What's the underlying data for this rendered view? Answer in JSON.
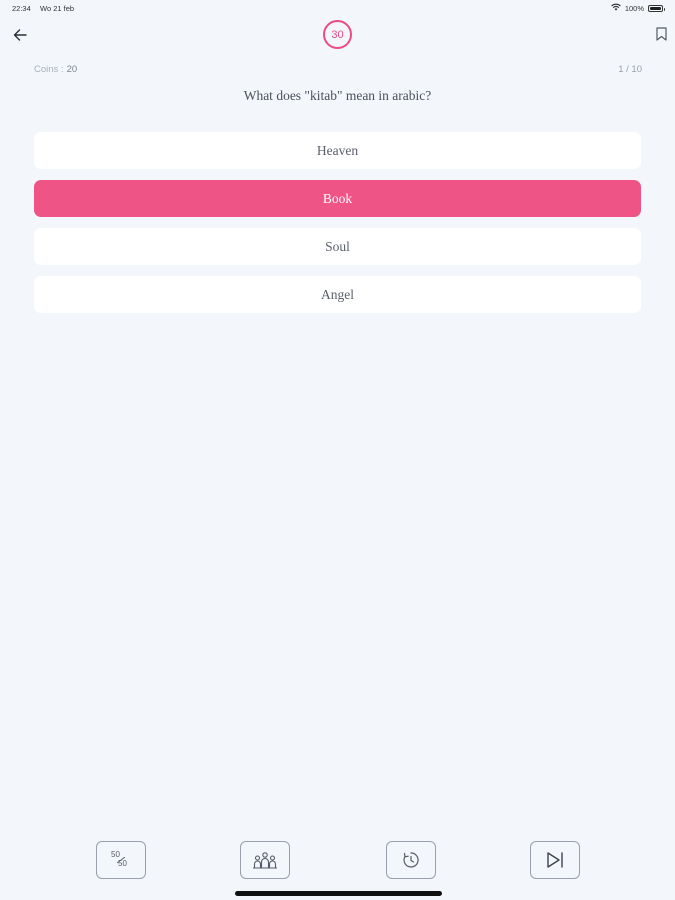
{
  "status_bar": {
    "time": "22:34",
    "date": "Wo 21 feb",
    "battery": "100%",
    "battery_level": 1.0
  },
  "header": {
    "timer_value": "30",
    "back_icon": "arrow-left-icon",
    "bookmark_icon": "bookmark-icon"
  },
  "quiz": {
    "coins_label": "Coins :",
    "coins_value": "20",
    "progress": "1 / 10",
    "question": "What does \"kitab\" mean in arabic?",
    "options": [
      {
        "label": "Heaven",
        "selected": false
      },
      {
        "label": "Book",
        "selected": true
      },
      {
        "label": "Soul",
        "selected": false
      },
      {
        "label": "Angel",
        "selected": false
      }
    ]
  },
  "toolbar": {
    "fifty_top": "50",
    "fifty_bottom": "50",
    "icons": [
      "fifty-fifty-icon",
      "audience-icon",
      "extra-time-icon",
      "skip-icon"
    ]
  },
  "colors": {
    "accent": "#ef5487",
    "background": "#f3f6fa",
    "card": "#ffffff"
  }
}
